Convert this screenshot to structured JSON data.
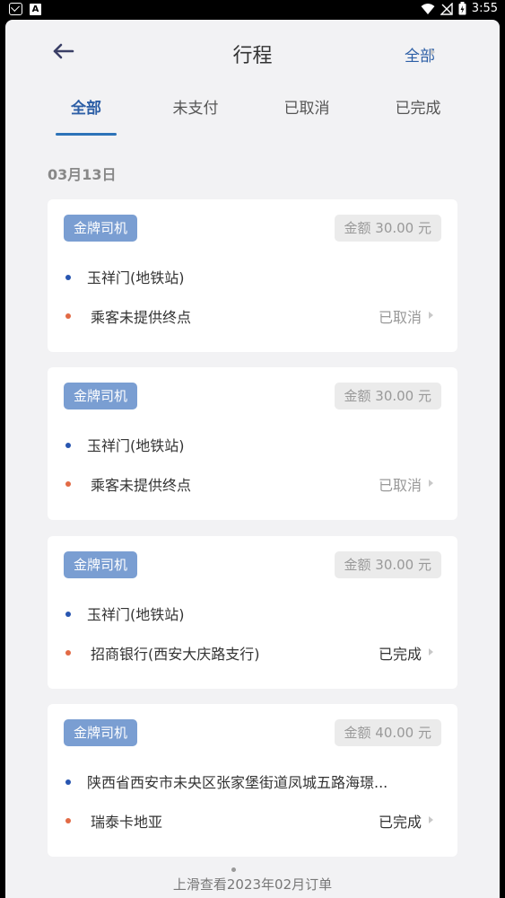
{
  "statusbar": {
    "time": "3:55",
    "icons": [
      "mail-icon",
      "a-icon",
      "wifi-icon",
      "signal-icon",
      "battery-icon"
    ]
  },
  "header": {
    "title": "行程",
    "filter_label": "全部",
    "back_icon": "back-arrow-icon"
  },
  "tabs": [
    {
      "label": "全部",
      "active": true
    },
    {
      "label": "未支付",
      "active": false
    },
    {
      "label": "已取消",
      "active": false
    },
    {
      "label": "已完成",
      "active": false
    }
  ],
  "date_heading": "03月13日",
  "trips": [
    {
      "badge": "金牌司机",
      "amount": "金额 30.00 元",
      "start": "玉祥门(地铁站)",
      "end": "乘客未提供终点",
      "status": "已取消"
    },
    {
      "badge": "金牌司机",
      "amount": "金额 30.00 元",
      "start": "玉祥门(地铁站)",
      "end": "乘客未提供终点",
      "status": "已取消"
    },
    {
      "badge": "金牌司机",
      "amount": "金额 30.00 元",
      "start": "玉祥门(地铁站)",
      "end": "招商银行(西安大庆路支行)",
      "status": "已完成"
    },
    {
      "badge": "金牌司机",
      "amount": "金额 40.00 元",
      "start": "陕西省西安市未央区张家堡街道凤城五路海璟...",
      "end": "瑞泰卡地亚",
      "status": "已完成"
    }
  ],
  "footer": {
    "text": "上滑查看2023年02月订单"
  },
  "colors": {
    "accent": "#2d5fa6",
    "badge": "#7a9ed2",
    "start_dot": "#2855b0",
    "end_dot": "#e26a45",
    "background": "#f2f2f4"
  }
}
